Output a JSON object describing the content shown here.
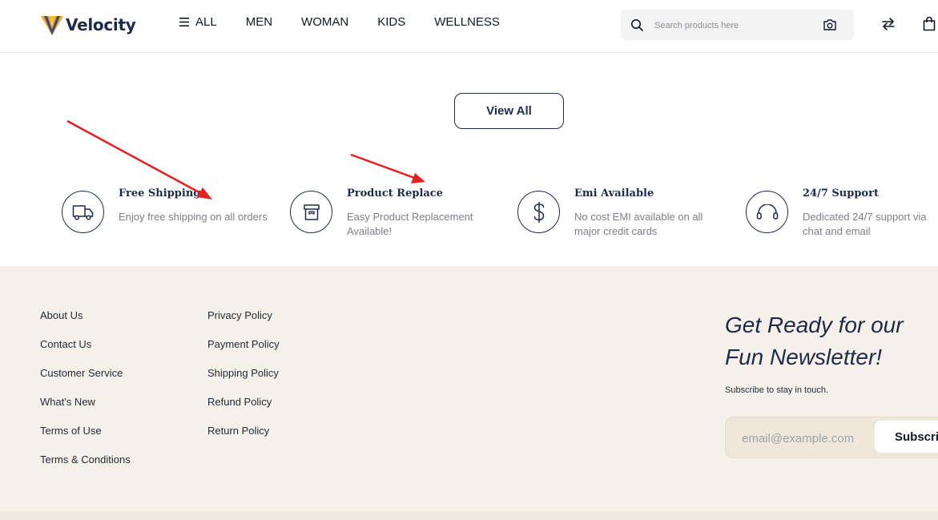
{
  "header": {
    "brand": "Velocity",
    "nav": [
      {
        "label": "ALL"
      },
      {
        "label": "MEN"
      },
      {
        "label": "WOMAN"
      },
      {
        "label": "KIDS"
      },
      {
        "label": "WELLNESS"
      }
    ],
    "search": {
      "placeholder": "Search products here"
    }
  },
  "main": {
    "view_all_label": "View All"
  },
  "features": [
    {
      "title": "Free Shipping",
      "desc": "Enjoy free shipping on all orders",
      "icon": "truck-icon"
    },
    {
      "title": "Product Replace",
      "desc": "Easy Product Replacement Available!",
      "icon": "box-icon"
    },
    {
      "title": "Emi Available",
      "desc": "No cost EMI available on all major credit cards",
      "icon": "dollar-icon"
    },
    {
      "title": "24/7 Support",
      "desc": "Dedicated 24/7 support via chat and email",
      "icon": "headphones-icon"
    }
  ],
  "footer": {
    "col1": [
      "About Us",
      "Contact Us",
      "Customer Service",
      "What's New",
      "Terms of Use",
      "Terms & Conditions"
    ],
    "col2": [
      "Privacy Policy",
      "Payment Policy",
      "Shipping Policy",
      "Refund Policy",
      "Return Policy"
    ],
    "newsletter": {
      "title": "Get Ready for our Fun Newsletter!",
      "subtitle": "Subscribe to stay in touch.",
      "placeholder": "email@example.com",
      "button": "Subscribe"
    }
  },
  "colors": {
    "navy": "#1e2a4a",
    "logo_gold": "#f5a623",
    "annotation_red": "#e52020",
    "footer_bg": "#f5f0e9"
  }
}
